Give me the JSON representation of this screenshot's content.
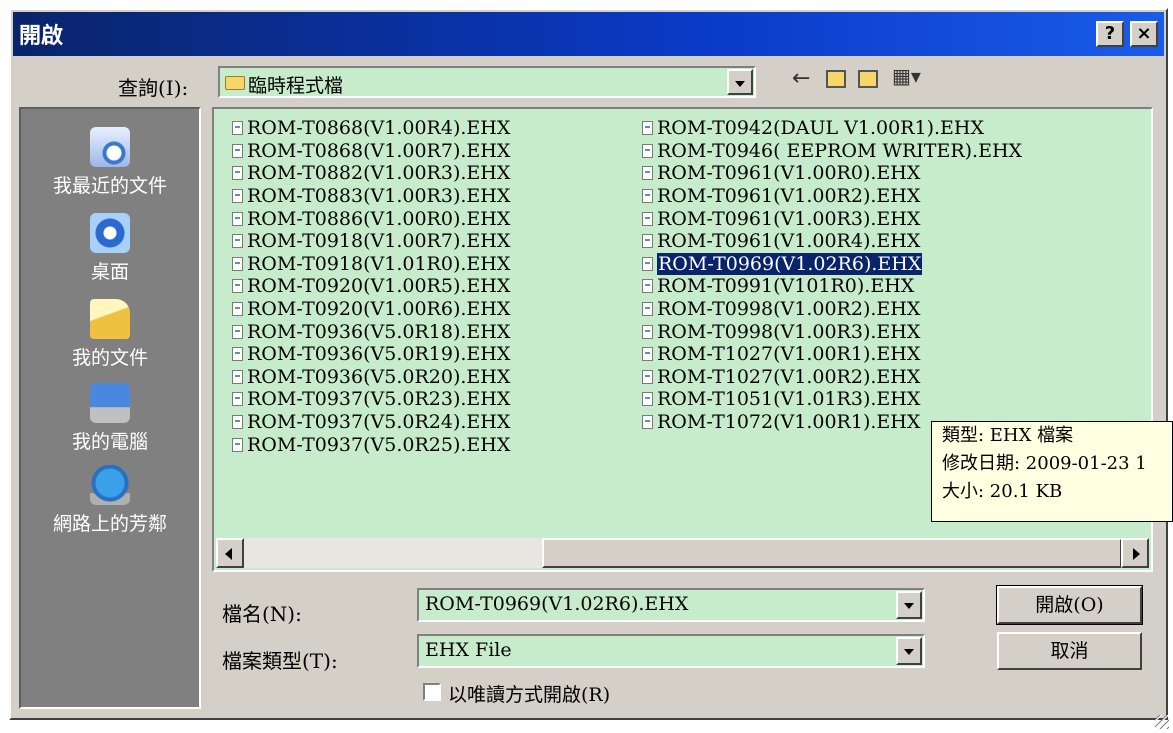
{
  "window": {
    "title": "開啟",
    "help_label": "?",
    "close_label": "×"
  },
  "toolbar": {
    "lookin_label": "查詢(I):",
    "lookin_value": "臨時程式檔",
    "back_glyph": "←",
    "uplevel_glyph": "⬆",
    "newfolder_glyph": "✱",
    "view_glyph": "▦▾"
  },
  "places": [
    {
      "label": "我最近的文件",
      "icon": "recent-documents-icon"
    },
    {
      "label": "桌面",
      "icon": "desktop-icon"
    },
    {
      "label": "我的文件",
      "icon": "my-documents-icon"
    },
    {
      "label": "我的電腦",
      "icon": "my-computer-icon"
    },
    {
      "label": "網路上的芳鄰",
      "icon": "network-places-icon"
    }
  ],
  "files": {
    "col1": [
      "ROM-T0868(V1.00R4).EHX",
      "ROM-T0868(V1.00R7).EHX",
      "ROM-T0882(V1.00R3).EHX",
      "ROM-T0883(V1.00R3).EHX",
      "ROM-T0886(V1.00R0).EHX",
      "ROM-T0918(V1.00R7).EHX",
      "ROM-T0918(V1.01R0).EHX",
      "ROM-T0920(V1.00R5).EHX",
      "ROM-T0920(V1.00R6).EHX",
      "ROM-T0936(V5.0R18).EHX",
      "ROM-T0936(V5.0R19).EHX",
      "ROM-T0936(V5.0R20).EHX",
      "ROM-T0937(V5.0R23).EHX",
      "ROM-T0937(V5.0R24).EHX",
      "ROM-T0937(V5.0R25).EHX"
    ],
    "col2": [
      "ROM-T0942(DAUL V1.00R1).EHX",
      "ROM-T0946( EEPROM WRITER).EHX",
      "ROM-T0961(V1.00R0).EHX",
      "ROM-T0961(V1.00R2).EHX",
      "ROM-T0961(V1.00R3).EHX",
      "ROM-T0961(V1.00R4).EHX",
      "ROM-T0969(V1.02R6).EHX",
      "ROM-T0991(V101R0).EHX",
      "ROM-T0998(V1.00R2).EHX",
      "ROM-T0998(V1.00R3).EHX",
      "ROM-T1027(V1.00R1).EHX",
      "ROM-T1027(V1.00R2).EHX",
      "ROM-T1051(V1.01R3).EHX",
      "ROM-T1072(V1.00R1).EHX"
    ],
    "selected": "ROM-T0969(V1.02R6).EHX"
  },
  "tooltip": {
    "type_line": "類型: EHX 檔案",
    "date_line": "修改日期: 2009-01-23 1",
    "size_line": "大小: 20.1 KB"
  },
  "filename": {
    "label": "檔名(N):",
    "value": "ROM-T0969(V1.02R6).EHX"
  },
  "filetype": {
    "label": "檔案類型(T):",
    "value": "EHX File"
  },
  "readonly": {
    "label": "以唯讀方式開啟(R)"
  },
  "buttons": {
    "open": "開啟(O)",
    "cancel": "取消"
  },
  "colors": {
    "list_bg": "#c7eccb",
    "title_bg": "#0a246a",
    "selection": "#0a246a",
    "tooltip_bg": "#ffffe1"
  }
}
